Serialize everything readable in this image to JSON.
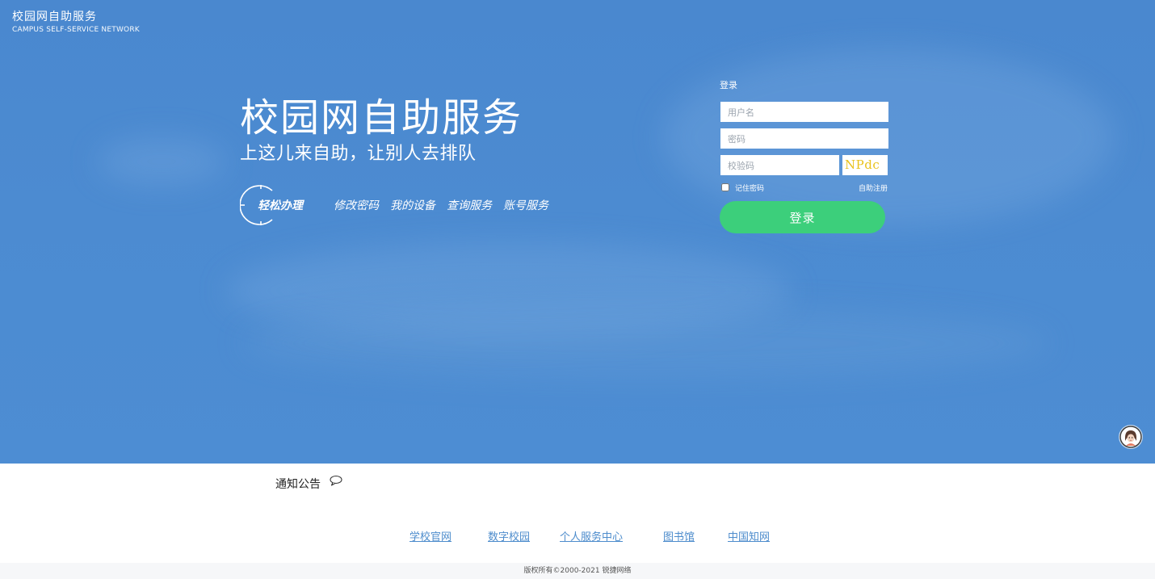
{
  "brand": {
    "name_cn": "校园网自助服务",
    "name_en": "CAMPUS  SELF-SERVICE NETWORK"
  },
  "hero": {
    "title": "校园网自助服务",
    "slogan": "上这儿来自助，让别人去排队",
    "badge_label": "轻松办理",
    "services": [
      "修改密码",
      "我的设备",
      "查询服务",
      "账号服务"
    ]
  },
  "login": {
    "heading": "登录",
    "username_placeholder": "用户名",
    "password_placeholder": "密码",
    "captcha_placeholder": "校验码",
    "captcha_text": "NPdc",
    "remember_label": "记住密码",
    "register_label": "自助注册",
    "submit_label": "登录"
  },
  "notice": {
    "title": "通知公告"
  },
  "footer": {
    "links": [
      "学校官网",
      "数字校园",
      "个人服务中心",
      "图书馆",
      "中国知网"
    ],
    "copyright": "版权所有©2000-2021 锐捷网络"
  },
  "colors": {
    "hero_blue": "#4c8bd1",
    "login_button": "#3ccf7b",
    "link_blue": "#4d8ccc",
    "captcha_text": "#e9c21c"
  },
  "icons": {
    "notice": "speech-bubble-icon",
    "support": "support-avatar-icon",
    "badge": "circle-badge-icon"
  }
}
